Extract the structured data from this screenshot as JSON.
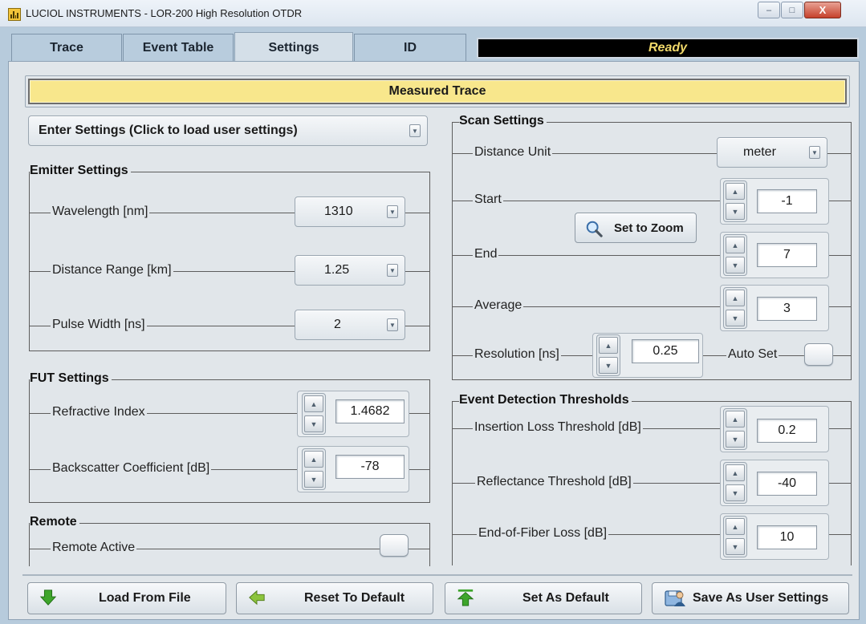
{
  "window": {
    "title": "LUCIOL INSTRUMENTS - LOR-200 High Resolution OTDR",
    "minimize_glyph": "–",
    "maximize_glyph": "□",
    "close_glyph": "X"
  },
  "tabs": [
    {
      "label": "Trace",
      "active": false
    },
    {
      "label": "Event Table",
      "active": false
    },
    {
      "label": "Settings",
      "active": true
    },
    {
      "label": "ID",
      "active": false
    }
  ],
  "status": "Ready",
  "measured_trace": "Measured Trace",
  "enter_settings": {
    "label": "Enter Settings (Click to load user settings)"
  },
  "emitter": {
    "title": "Emitter Settings",
    "wavelength": {
      "label": "Wavelength [nm]",
      "value": "1310"
    },
    "distance_range": {
      "label": "Distance Range [km]",
      "value": "1.25"
    },
    "pulse_width": {
      "label": "Pulse Width [ns]",
      "value": "2"
    }
  },
  "fut": {
    "title": "FUT Settings",
    "refractive_index": {
      "label": "Refractive Index",
      "value": "1.4682"
    },
    "backscatter": {
      "label": "Backscatter Coefficient [dB]",
      "value": "-78"
    }
  },
  "remote": {
    "title": "Remote",
    "active": {
      "label": "Remote Active",
      "checked": false
    }
  },
  "scan": {
    "title": "Scan Settings",
    "distance_unit": {
      "label": "Distance Unit",
      "value": "meter"
    },
    "start": {
      "label": "Start",
      "value": "-1"
    },
    "set_to_zoom": "Set to Zoom",
    "end": {
      "label": "End",
      "value": "7"
    },
    "average": {
      "label": "Average",
      "value": "3"
    },
    "resolution": {
      "label": "Resolution [ns]",
      "value": "0.25"
    },
    "auto_set": {
      "label": "Auto Set",
      "checked": false
    }
  },
  "thresholds": {
    "title": "Event Detection Thresholds",
    "insertion_loss": {
      "label": "Insertion Loss Threshold [dB]",
      "value": "0.2"
    },
    "reflectance": {
      "label": "Reflectance Threshold [dB]",
      "value": "-40"
    },
    "end_of_fiber": {
      "label": "End-of-Fiber Loss [dB]",
      "value": "10"
    }
  },
  "buttons": {
    "load": "Load From File",
    "reset": "Reset To Default",
    "set_default": "Set As Default",
    "save_user": "Save As User Settings"
  },
  "icons": {
    "app": "oscilloscope-icon",
    "load": "arrow-down-icon",
    "reset": "arrow-left-icon",
    "set_default": "arrow-up-icon",
    "save_user": "save-person-icon",
    "zoom": "magnifier-icon"
  },
  "colors": {
    "app_background": "#b7cbdc",
    "panel": "#e1e6ea",
    "measured_bar": "#f8e78c",
    "status_background": "#000000",
    "status_text": "#f1d96a",
    "arrow_green": "#3ea52b"
  }
}
